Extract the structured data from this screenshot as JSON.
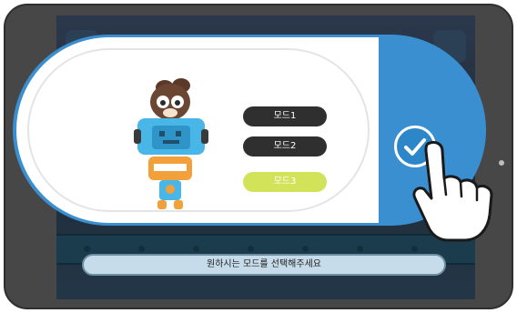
{
  "app": {
    "name": "mode-select-game"
  },
  "modes": [
    {
      "label": "모드1",
      "selected": false
    },
    {
      "label": "모드2",
      "selected": false
    },
    {
      "label": "모드3",
      "selected": true
    }
  ],
  "confirm": {
    "icon": "check-icon"
  },
  "status": {
    "text": "원하시는 모드를 선택해주세요"
  },
  "colors": {
    "tablet_frame": "#474747",
    "panel_blue": "#3a8fd0",
    "mode_dark": "#2f2f2f",
    "mode_selected": "#d2e35a",
    "status_bar": "#c7dcea"
  }
}
